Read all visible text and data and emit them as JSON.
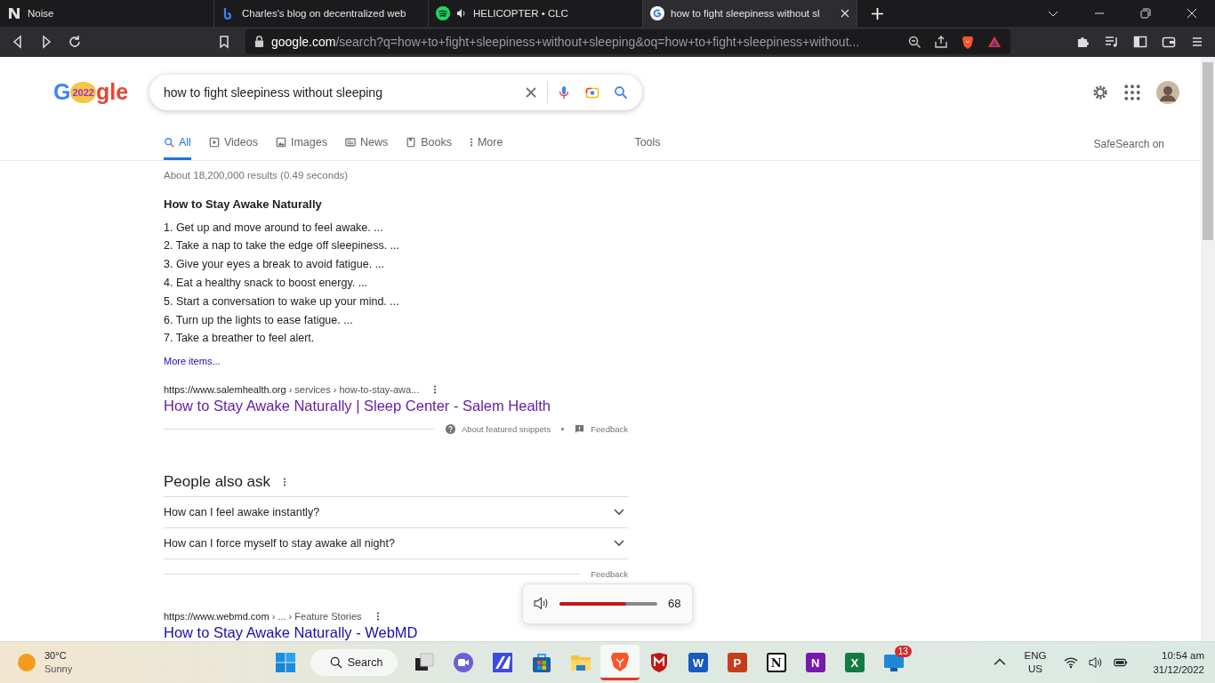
{
  "browser": {
    "tabs": [
      {
        "title": "Noise",
        "kind": "notion",
        "selected": false,
        "playing_audio": false
      },
      {
        "title": "Charles's blog on decentralized web",
        "kind": "blog",
        "selected": false,
        "playing_audio": false
      },
      {
        "title": "HELICOPTER • CLC",
        "kind": "spotify",
        "selected": false,
        "playing_audio": true
      },
      {
        "title": "how to fight sleepiness without sl",
        "kind": "google",
        "selected": true,
        "playing_audio": false
      }
    ],
    "address": {
      "domain": "google.com",
      "path": "/search?q=how+to+fight+sleepiness+without+sleeping&oq=how+to+fight+sleepiness+without..."
    }
  },
  "google": {
    "logo": {
      "left": "G",
      "doodle": "2022",
      "right": "gle"
    },
    "search": {
      "value": "how to fight sleepiness without sleeping"
    },
    "nav": [
      {
        "label": "All",
        "kind": "search",
        "selected": true
      },
      {
        "label": "Videos",
        "kind": "video",
        "selected": false
      },
      {
        "label": "Images",
        "kind": "image",
        "selected": false
      },
      {
        "label": "News",
        "kind": "news",
        "selected": false
      },
      {
        "label": "Books",
        "kind": "book",
        "selected": false
      },
      {
        "label": "More",
        "kind": "more",
        "selected": false
      }
    ],
    "tools": "Tools",
    "safesearch": "SafeSearch on",
    "stats": "About 18,200,000 results (0.49 seconds)",
    "snippet": {
      "heading": "How to Stay Awake Naturally",
      "items": [
        "1. Get up and move around to feel awake. ...",
        "2. Take a nap to take the edge off sleepiness. ...",
        "3. Give your eyes a break to avoid fatigue. ...",
        "4. Eat a healthy snack to boost energy. ...",
        "5. Start a conversation to wake up your mind. ...",
        "6. Turn up the lights to ease fatigue. ...",
        "7. Take a breather to feel alert."
      ],
      "more": "More items...",
      "source": {
        "site": "https://www.salemhealth.org",
        "path": " › services › how-to-stay-awa...",
        "title": "How to Stay Awake Naturally | Sleep Center - Salem Health",
        "visited": true
      },
      "about": "About featured snippets",
      "feedback": "Feedback"
    },
    "people_also_ask": {
      "heading": "People also ask",
      "questions": [
        {
          "text": "How can I feel awake instantly?",
          "expanded": false
        },
        {
          "text": "How can I force myself to stay awake all night?",
          "expanded": false
        }
      ],
      "feedback": "Feedback"
    },
    "results": [
      {
        "site": "https://www.webmd.com",
        "path": " › ... › Feature Stories",
        "title": "How to Stay Awake Naturally - WebMD",
        "visited": false
      }
    ]
  },
  "volume": {
    "level": 0.68,
    "reading": "68"
  },
  "taskbar": {
    "weather": {
      "temp": "30°C",
      "condition": "Sunny"
    },
    "search": "Search",
    "apps": [
      {
        "kind": "taskview",
        "selected": false
      },
      {
        "kind": "chat",
        "selected": false
      },
      {
        "kind": "editor",
        "selected": false
      },
      {
        "kind": "store",
        "selected": false
      },
      {
        "kind": "files",
        "selected": false
      },
      {
        "kind": "brave",
        "selected": true
      },
      {
        "kind": "shield",
        "selected": false
      },
      {
        "kind": "office",
        "glyph": "W",
        "color": "#185abd",
        "selected": false
      },
      {
        "kind": "office",
        "glyph": "P",
        "color": "#c43e1c",
        "selected": false
      },
      {
        "kind": "notion",
        "glyph": "N",
        "color": "#ffffff",
        "selected": false
      },
      {
        "kind": "office",
        "glyph": "N",
        "color": "#7719aa",
        "selected": false
      },
      {
        "kind": "office",
        "glyph": "X",
        "color": "#107c41",
        "selected": false
      },
      {
        "kind": "remote",
        "badge": "13",
        "selected": false
      }
    ],
    "lang": "ENG",
    "region": "US",
    "time": "10:54 am",
    "date": "31/12/2022"
  }
}
